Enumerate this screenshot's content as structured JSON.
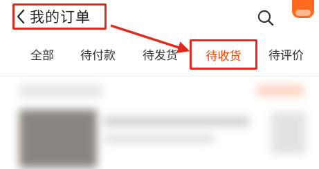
{
  "header": {
    "title": "我的订单",
    "back_icon": "chevron-left-icon",
    "search_icon": "search-icon"
  },
  "tabs": [
    {
      "label": "全部",
      "active": false
    },
    {
      "label": "待付款",
      "active": false
    },
    {
      "label": "待发货",
      "active": false
    },
    {
      "label": "待收货",
      "active": true
    },
    {
      "label": "待评价",
      "active": false
    }
  ],
  "colors": {
    "accent": "#ff4400",
    "annotation_red": "#e3281c"
  }
}
